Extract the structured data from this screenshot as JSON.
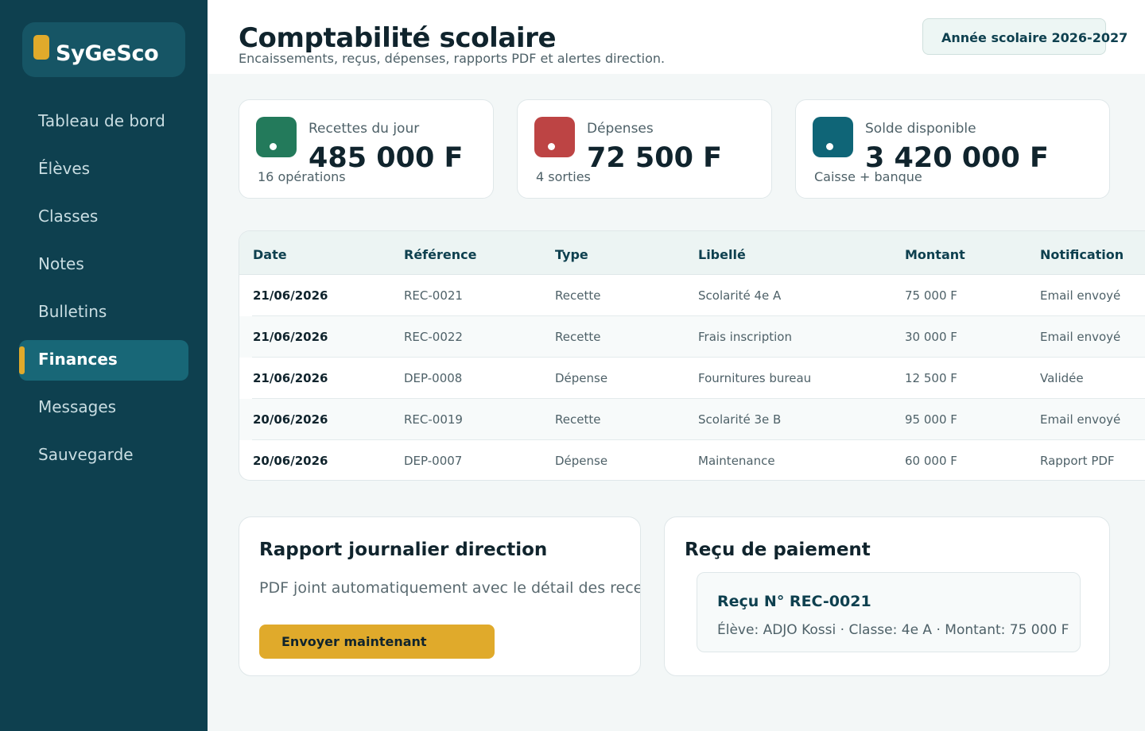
{
  "app": {
    "name": "SyGeSco"
  },
  "sidebar": {
    "items": [
      {
        "label": "Tableau de bord",
        "active": false
      },
      {
        "label": "Élèves",
        "active": false
      },
      {
        "label": "Classes",
        "active": false
      },
      {
        "label": "Notes",
        "active": false
      },
      {
        "label": "Bulletins",
        "active": false
      },
      {
        "label": "Finances",
        "active": true
      },
      {
        "label": "Messages",
        "active": false
      },
      {
        "label": "Sauvegarde",
        "active": false
      }
    ]
  },
  "header": {
    "title": "Comptabilité scolaire",
    "subtitle": "Encaissements, reçus, dépenses, rapports PDF et alertes direction.",
    "year_badge": "Année scolaire 2026-2027"
  },
  "stats": [
    {
      "label": "Recettes du jour",
      "value": "485 000 F",
      "note": "16 opérations",
      "color": "#237a5b",
      "icon": "income-icon"
    },
    {
      "label": "Dépenses",
      "value": "72 500 F",
      "note": "4 sorties",
      "color": "#bd4444",
      "icon": "expense-icon"
    },
    {
      "label": "Solde disponible",
      "value": "3 420 000 F",
      "note": "Caisse + banque",
      "color": "#0f6577",
      "icon": "balance-icon"
    }
  ],
  "table": {
    "columns": [
      "Date",
      "Référence",
      "Type",
      "Libellé",
      "Montant",
      "Notification"
    ],
    "rows": [
      [
        "21/06/2026",
        "REC-0021",
        "Recette",
        "Scolarité 4e A",
        "75 000 F",
        "Email envoyé"
      ],
      [
        "21/06/2026",
        "REC-0022",
        "Recette",
        "Frais inscription",
        "30 000 F",
        "Email envoyé"
      ],
      [
        "21/06/2026",
        "DEP-0008",
        "Dépense",
        "Fournitures bureau",
        "12 500 F",
        "Validée"
      ],
      [
        "20/06/2026",
        "REC-0019",
        "Recette",
        "Scolarité 3e B",
        "95 000 F",
        "Email envoyé"
      ],
      [
        "20/06/2026",
        "DEP-0007",
        "Dépense",
        "Maintenance",
        "60 000 F",
        "Rapport PDF"
      ]
    ]
  },
  "report": {
    "title": "Rapport journalier direction",
    "text": "PDF joint automatiquement avec le détail des recettes, dépenses",
    "button_label": "Envoyer maintenant"
  },
  "receipt": {
    "title": "Reçu de paiement",
    "number": "Reçu N° REC-0021",
    "detail": "Élève: ADJO Kossi · Classe: 4e A · Montant: 75 000 F"
  },
  "colors": {
    "sidebar": "#0e404f",
    "accent": "#e0aa2b",
    "active_item": "#186777"
  }
}
